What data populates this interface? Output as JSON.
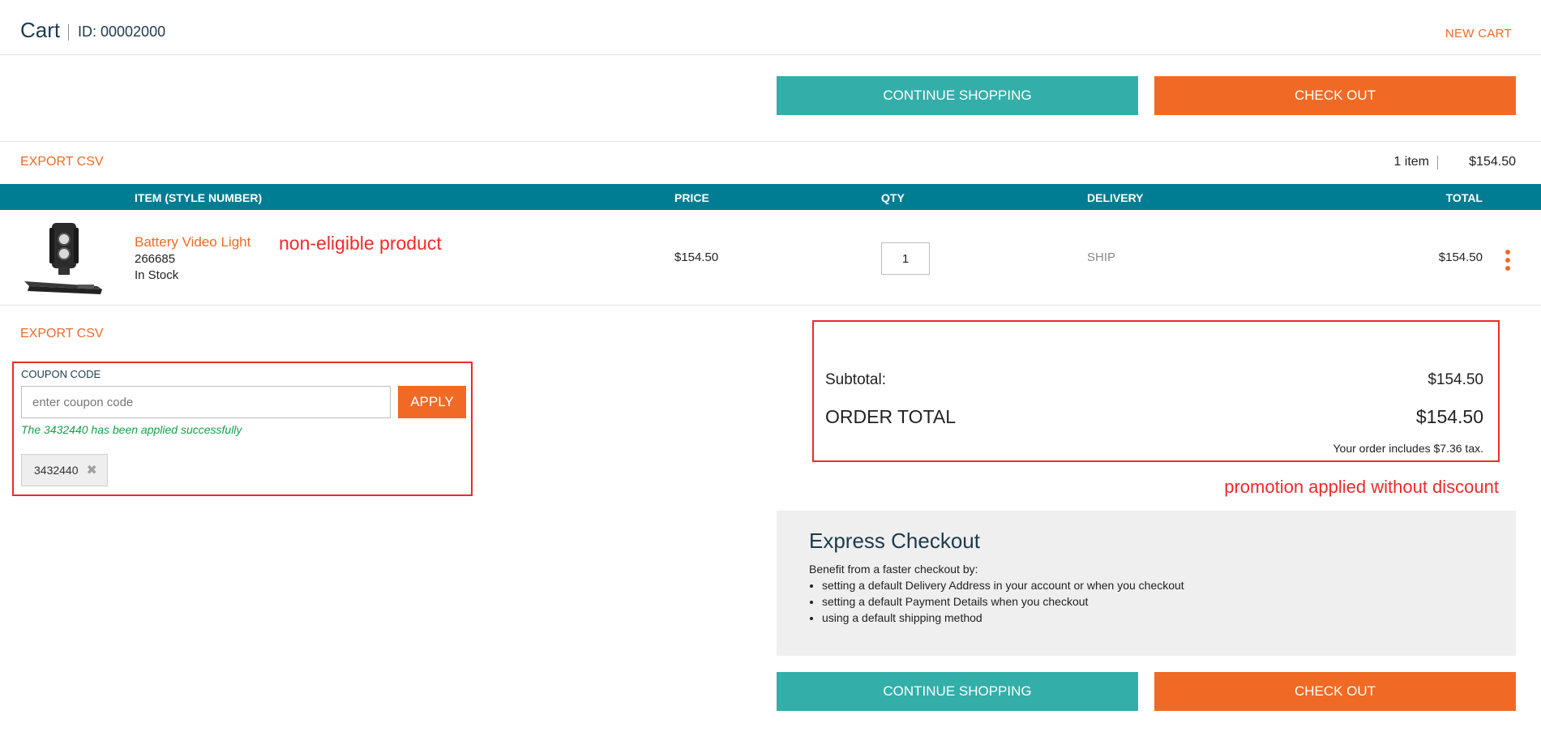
{
  "header": {
    "title": "Cart",
    "id_label": "ID: 00002000",
    "new_cart": "NEW CART"
  },
  "actions": {
    "continue_shopping": "CONTINUE SHOPPING",
    "check_out": "CHECK OUT"
  },
  "summary": {
    "export_csv": "EXPORT CSV",
    "item_count": "1 item",
    "total": "$154.50"
  },
  "table": {
    "headers": {
      "item": "ITEM (STYLE NUMBER)",
      "price": "PRICE",
      "qty": "QTY",
      "delivery": "DELIVERY",
      "total": "TOTAL"
    },
    "rows": [
      {
        "name": "Battery Video Light",
        "style_number": "266685",
        "stock": "In Stock",
        "price": "$154.50",
        "qty": "1",
        "delivery": "SHIP",
        "total": "$154.50"
      }
    ]
  },
  "annotations": {
    "non_eligible": "non-eligible product",
    "promotion": "promotion applied without discount"
  },
  "coupon": {
    "export_csv": "EXPORT CSV",
    "label": "COUPON CODE",
    "placeholder": "enter coupon code",
    "apply": "APPLY",
    "success_message": "The 3432440 has been applied successfully",
    "applied_code": "3432440"
  },
  "totals": {
    "subtotal_label": "Subtotal:",
    "subtotal_value": "$154.50",
    "order_total_label": "ORDER TOTAL",
    "order_total_value": "$154.50",
    "tax_note": "Your order includes $7.36 tax."
  },
  "express": {
    "title": "Express Checkout",
    "intro": "Benefit from a faster checkout by:",
    "items": [
      "setting a default Delivery Address in your account or when you checkout",
      "setting a default Payment Details when you checkout",
      "using a default shipping method"
    ]
  },
  "colors": {
    "accent_orange": "#f06a25",
    "accent_teal": "#33aea9",
    "table_header": "#007d93",
    "annotation_red": "#ee2b2b",
    "success_green": "#14a04a"
  },
  "icons": {
    "more": "kebab-menu-icon",
    "remove_coupon": "close-icon",
    "product_image": "battery-video-light-image"
  }
}
